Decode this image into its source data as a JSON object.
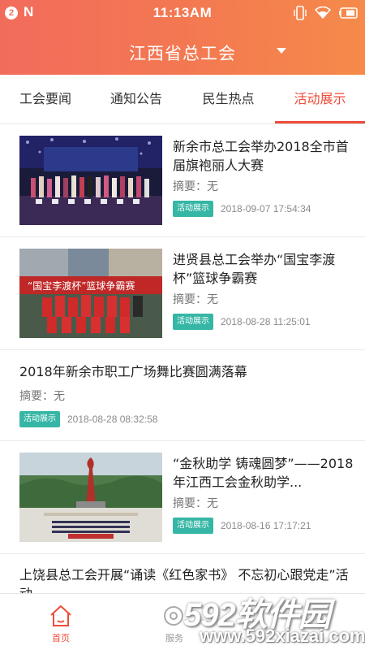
{
  "status_bar": {
    "notification_count": "2",
    "app_letter": "N",
    "time": "11:13AM"
  },
  "header": {
    "title": "江西省总工会"
  },
  "tabs": [
    {
      "label": "工会要闻",
      "active": false
    },
    {
      "label": "通知公告",
      "active": false
    },
    {
      "label": "民生热点",
      "active": false
    },
    {
      "label": "活动展示",
      "active": true
    }
  ],
  "articles": [
    {
      "title": "新余市总工会举办2018全市首届旗袍丽人大赛",
      "summary": "摘要：无",
      "tag": "活动展示",
      "date": "2018-09-07 17:54:34",
      "image": "stage-award-photo"
    },
    {
      "title": "进贤县总工会举办“国宝李渡杯”篮球争霸赛",
      "summary": "摘要：无",
      "tag": "活动展示",
      "date": "2018-08-28 11:25:01",
      "image": "basketball-team-photo",
      "banner_text": "“国宝李渡杯”篮球争霸赛"
    },
    {
      "title": "2018年新余市职工广场舞比赛圆满落幕",
      "summary": "摘要：无",
      "tag": "活动展示",
      "date": "2018-08-28 08:32:58"
    },
    {
      "title": "“金秋助学 铸魂圆梦”——2018年江西工会金秋助学...",
      "summary": "摘要：无",
      "tag": "活动展示",
      "date": "2018-08-16 17:17:21",
      "image": "monument-plaza-photo"
    },
    {
      "title": "上饶县总工会开展“诵读《红色家书》 不忘初心跟党走”活动"
    }
  ],
  "bottom_nav": {
    "home_label": "首页",
    "service_label": "服务"
  },
  "watermark": {
    "main": "592软件园",
    "url": "www.592xiazai.com"
  },
  "colors": {
    "header_gradient_start": "#f26c5c",
    "header_gradient_end": "#f58a4a",
    "accent": "#ef4b3a",
    "tag_bg": "#36b6a5"
  }
}
